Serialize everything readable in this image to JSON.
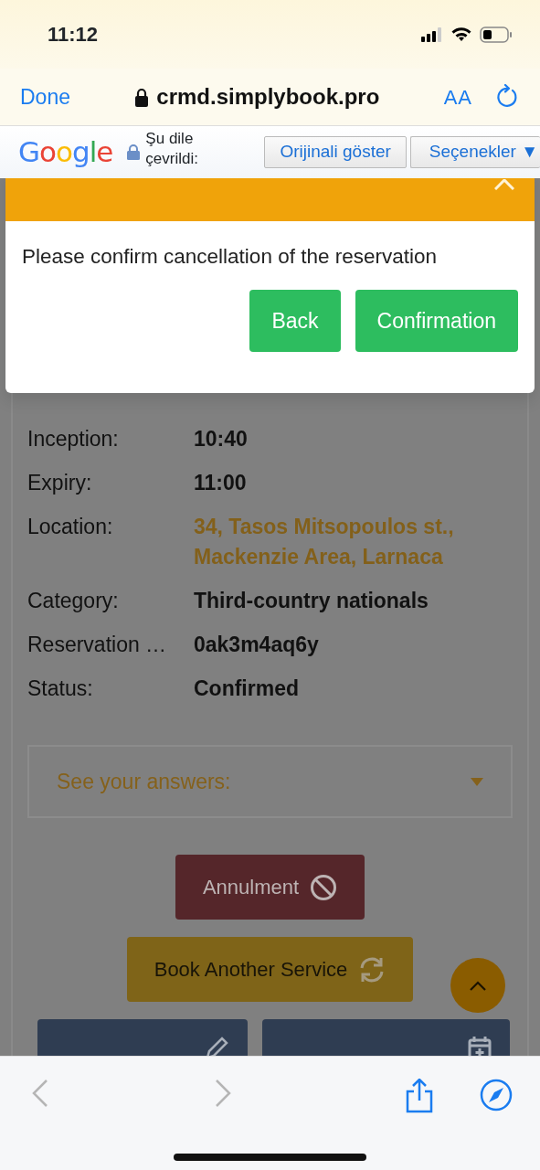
{
  "status_bar": {
    "time": "11:12"
  },
  "browser": {
    "done": "Done",
    "url": "crmd.simplybook.pro",
    "text_size": "AA"
  },
  "translate_bar": {
    "logo": "Google",
    "message": "Şu dile çevrildi:",
    "buttons": [
      "Orijinali göster",
      "Seçenekler ▼"
    ]
  },
  "modal": {
    "message": "Please confirm cancellation of the reservation",
    "buttons": [
      {
        "label": "Back"
      },
      {
        "label": "Confirmation"
      }
    ]
  },
  "details": [
    {
      "label": "Inception:",
      "value": "10:40",
      "kind": "text"
    },
    {
      "label": "Expiry:",
      "value": "11:00",
      "kind": "text"
    },
    {
      "label": "Location:",
      "value": "34, Tasos Mitsopoulos st., Mackenzie Area, Larnaca",
      "kind": "link"
    },
    {
      "label": "Category:",
      "value": "Third-country nationals",
      "kind": "text"
    },
    {
      "label": "Reservation …",
      "value": "0ak3m4aq6y",
      "kind": "text"
    },
    {
      "label": "Status:",
      "value": "Confirmed",
      "kind": "text"
    }
  ],
  "answers": {
    "label": "See your answers:",
    "expanded": false
  },
  "actions": [
    {
      "label": "Annulment",
      "kind": "cancel"
    },
    {
      "label": "Book Another Service",
      "kind": "rebook"
    },
    {
      "kind": "edit"
    },
    {
      "kind": "calendar"
    }
  ],
  "toolbar": {
    "back_disabled": true,
    "forward_disabled": true
  }
}
